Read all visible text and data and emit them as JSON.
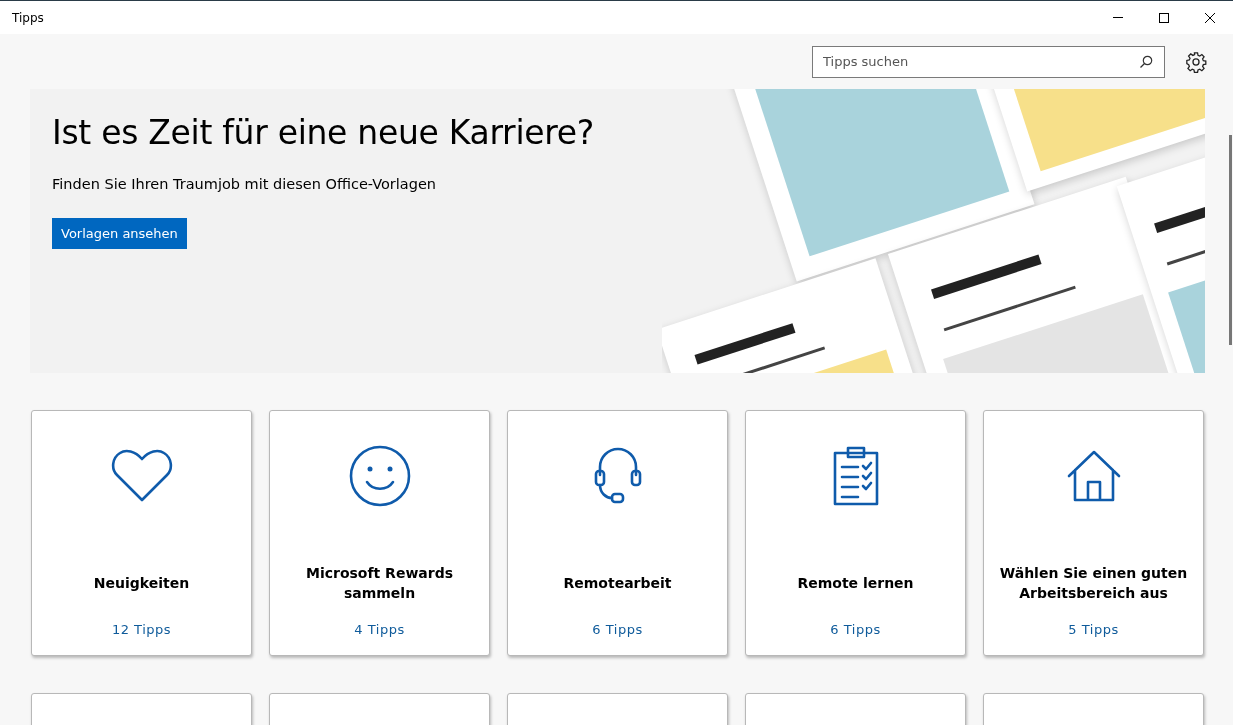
{
  "window": {
    "title": "Tipps"
  },
  "search": {
    "placeholder": "Tipps suchen"
  },
  "banner": {
    "heading": "Ist es Zeit für eine neue Karriere?",
    "subheading": "Finden Sie Ihren Traumjob mit diesen Office-Vorlagen",
    "button": "Vorlagen ansehen"
  },
  "cards": [
    {
      "title": "Neuigkeiten",
      "count": "12 Tipps"
    },
    {
      "title": "Microsoft Rewards sammeln",
      "count": "4 Tipps"
    },
    {
      "title": "Remotearbeit",
      "count": "6 Tipps"
    },
    {
      "title": "Remote lernen",
      "count": "6 Tipps"
    },
    {
      "title": "Wählen Sie einen guten Arbeitsbereich aus",
      "count": "5 Tipps"
    }
  ]
}
